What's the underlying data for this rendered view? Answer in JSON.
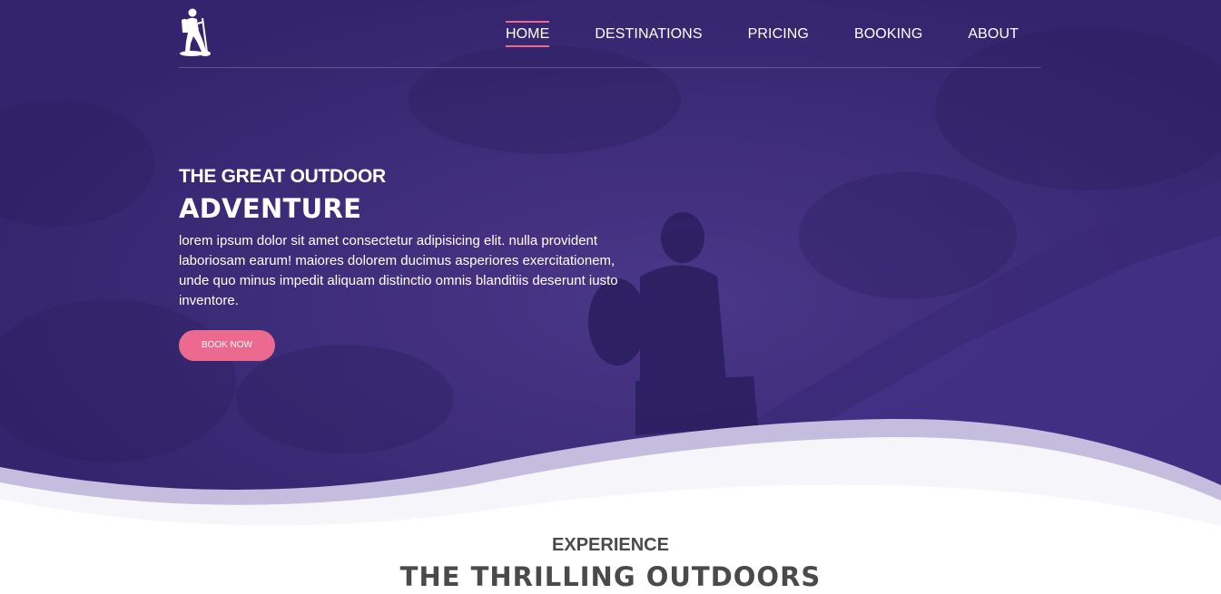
{
  "nav": {
    "items": [
      {
        "label": "HOME",
        "active": true
      },
      {
        "label": "DESTINATIONS",
        "active": false
      },
      {
        "label": "PRICING",
        "active": false
      },
      {
        "label": "BOOKING",
        "active": false
      },
      {
        "label": "ABOUT",
        "active": false
      }
    ],
    "logo_icon": "hiker-icon"
  },
  "hero": {
    "subtitle": "THE GREAT OUTDOOR",
    "title": "ADVENTURE",
    "text": "lorem ipsum dolor sit amet consectetur adipisicing elit. nulla provident laboriosam earum! maiores dolorem ducimus asperiores exercitationem, unde quo minus impedit aliquam distinctio omnis blanditiis deserunt iusto inventore.",
    "button_label": "BOOK NOW"
  },
  "section": {
    "subtitle": "EXPERIENCE",
    "title": "THE THRILLING OUTDOORS"
  },
  "colors": {
    "overlay": "#3b2a7a",
    "accent": "#ec6a90",
    "wave_light": "#c5bddd",
    "text_dark": "#4a4a4a"
  }
}
